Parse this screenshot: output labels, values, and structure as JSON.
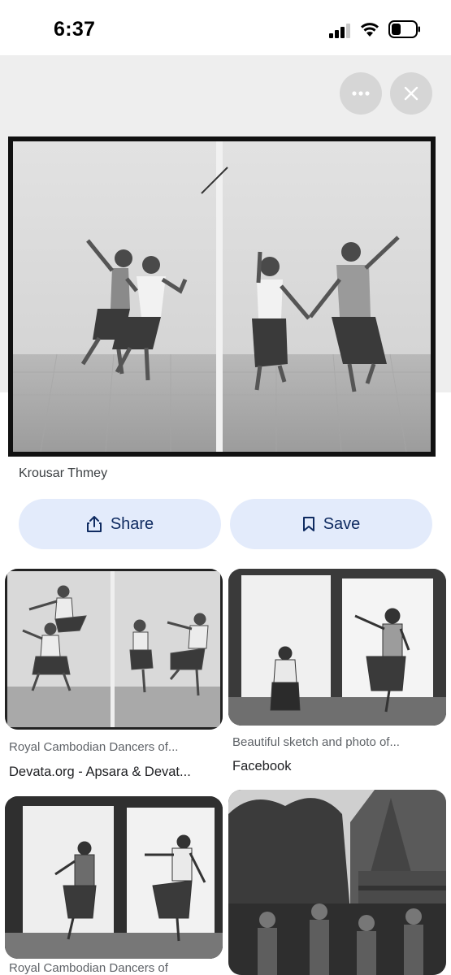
{
  "status_bar": {
    "time": "6:37",
    "icons": [
      "signal-icon",
      "wifi-icon",
      "battery-icon"
    ]
  },
  "viewer": {
    "more_icon": "more-horizontal-icon",
    "close_icon": "close-icon",
    "source": "Krousar Thmey"
  },
  "actions": {
    "share_label": "Share",
    "share_icon": "share-icon",
    "save_label": "Save",
    "save_icon": "bookmark-icon"
  },
  "results": [
    {
      "title": "Royal Cambodian Dancers of...",
      "source": "Devata.org - Apsara & Devat..."
    },
    {
      "title": "Beautiful sketch and photo of...",
      "source": "Facebook"
    },
    {
      "title": "Royal Cambodian Dancers of",
      "source": ""
    },
    {
      "title": "",
      "source": ""
    }
  ],
  "colors": {
    "button_bg": "#e3ebfb",
    "button_text": "#0f2b61",
    "viewer_bg": "#eeeeee"
  }
}
